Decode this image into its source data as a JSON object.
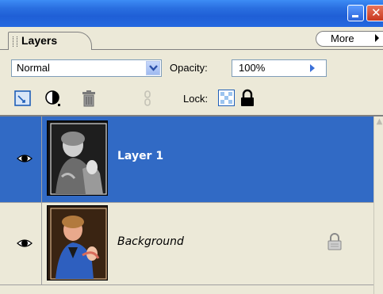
{
  "panel": {
    "tab_label": "Layers",
    "more_label": "More"
  },
  "blend": {
    "mode": "Normal",
    "opacity_label": "Opacity:",
    "opacity_value": "100%"
  },
  "lock": {
    "label": "Lock:"
  },
  "layers": [
    {
      "name": "Layer 1",
      "visible": true,
      "selected": true,
      "locked": false
    },
    {
      "name": "Background",
      "visible": true,
      "selected": false,
      "locked": true
    }
  ],
  "colors": {
    "titlebar": "#2a6fe0",
    "selection": "#316ac5",
    "panel_bg": "#ece9d8"
  },
  "icons": [
    "minimize-icon",
    "close-icon",
    "blend-dropdown-icon",
    "link-layers-icon",
    "adjustment-layer-icon",
    "trash-icon",
    "lock-pixels-icon",
    "lock-all-icon",
    "eye-icon",
    "lock-icon"
  ]
}
